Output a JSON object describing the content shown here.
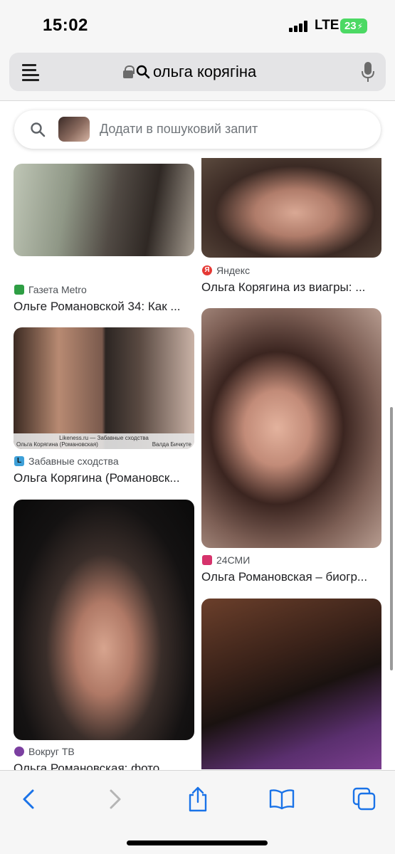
{
  "status_bar": {
    "time": "15:02",
    "network": "LTE",
    "battery": "23"
  },
  "address_bar": {
    "query": "ольга корягіна"
  },
  "search_chip": {
    "placeholder": "Додати в пошуковий запит"
  },
  "results": [
    {
      "source": "Газета Metro",
      "title": "Ольге Романовской 34: Как ...",
      "favicon_color": "#2e9e44"
    },
    {
      "source": "Яндекс",
      "title": "Ольга Корягина из виагры: ...",
      "favicon_color": "#e53935"
    },
    {
      "source": "Забавные сходства",
      "title": "Ольга Корягина (Романовск...",
      "favicon_color": "#3ea0d8"
    },
    {
      "source": "24СМИ",
      "title": "Ольга Романовская – биогр...",
      "favicon_color": "#d6336c"
    },
    {
      "source": "Вокруг ТВ",
      "title": "Ольга Романовская: фото",
      "favicon_color": "#7b3fa0"
    }
  ],
  "image_overlay": {
    "site": "Likeness.ru — Забавные сходства",
    "left_name": "Ольга Корягина (Романовская)",
    "right_name": "Валда Бичкуте"
  }
}
